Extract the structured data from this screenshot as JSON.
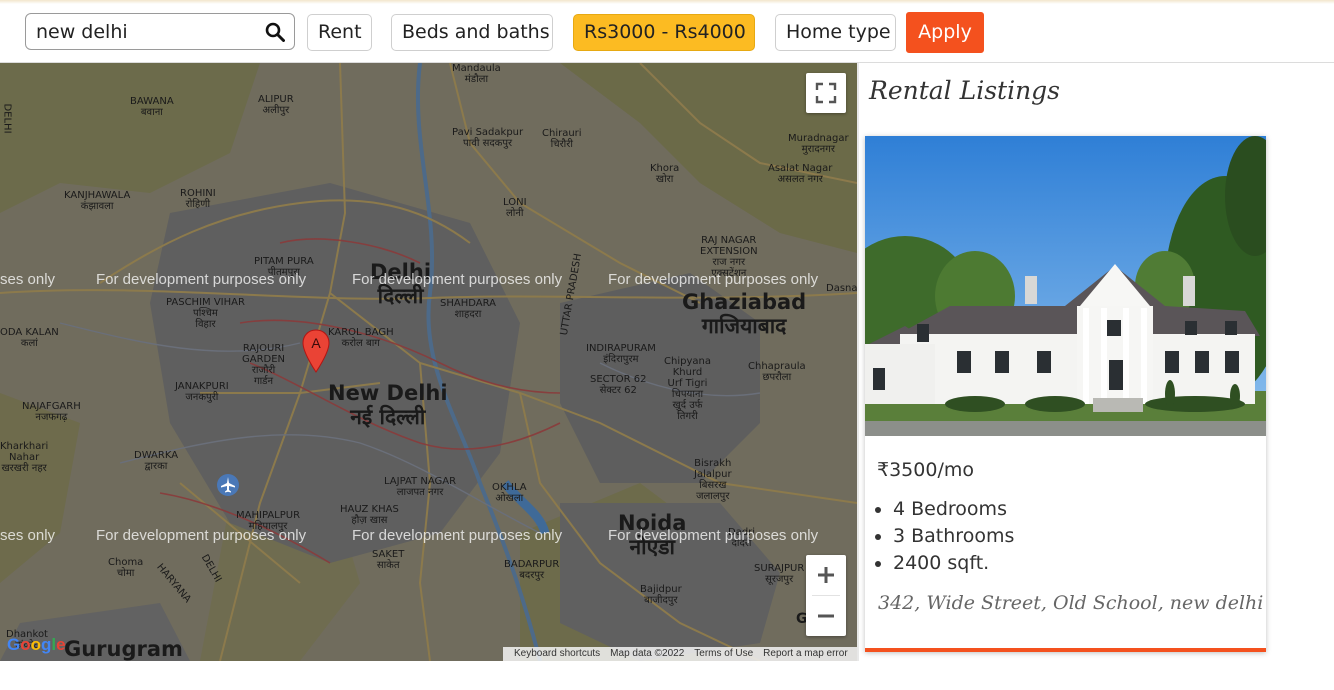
{
  "search": {
    "value": "new delhi"
  },
  "filters": {
    "rent_label": "Rent",
    "beds_baths_label": "Beds and baths",
    "price_label": "Rs3000 - Rs4000",
    "home_type_label": "Home type",
    "apply_label": "Apply"
  },
  "map": {
    "dev_watermark": "For development purposes only",
    "dev_watermark_clipped": "ses only",
    "marker_label": "A",
    "labels": {
      "delhi_en": "Delhi",
      "delhi_hi": "दिल्ली",
      "new_delhi_en": "New Delhi",
      "new_delhi_hi": "नई दिल्ली",
      "ghaziabad_en": "Ghaziabad",
      "ghaziabad_hi": "गाजियाबाद",
      "noida_en": "Noida",
      "noida_hi": "नोएडा",
      "gurugram": "Gurugram",
      "rohini": "ROHINI\nरोहिणी",
      "bawana": "BAWANA\nबवाना",
      "alipur": "ALIPUR\nअलीपुर",
      "mandaula": "Mandaula\nमंडौला",
      "pavi_sadakpur": "Pavi Sadakpur\nपावी सदकपुर",
      "chirauri": "Chirauri\nचिरौरी",
      "loni": "LONI\nलोनी",
      "khora": "Khora\nखोरा",
      "muradnagar": "Muradnagar\nमुरादनगर",
      "asalat_nagar": "Asalat Nagar\nअसलत नगर",
      "kanjhawala": "KANJHAWALA\nकंझावला",
      "raj_nagar": "RAJ NAGAR\nEXTENSION\nराज नगर\nएक्सटेंशन",
      "pitam_pura": "PITAM PURA\nपीतमपुरा",
      "paschim_vihar": "PASCHIM VIHAR\nपश्चिम\nविहार",
      "shahdara": "SHAHDARA\nशाहदरा",
      "karol_bagh": "KAROL BAGH\nकरोल बाग",
      "rajouri_garden": "RAJOURI\nGARDEN\nराजौरी\nगार्डन",
      "janakpuri": "JANAKPURI\nजनकपुरी",
      "najafgarh": "NAJAFGARH\nनजफगढ़",
      "indirapuram": "INDIRAPURAM\nइंदिरापुरम",
      "sector62": "SECTOR 62\nसेक्टर 62",
      "chipyana": "Chipyana\nKhurd\nUrf Tigri\nचिपयाना\nखुर्द उर्फ\nतिगरी",
      "chhapraula": "Chhapraula\nछपरौला",
      "kharkhari": "Kharkhari\nNahar\nखरखरी नहर",
      "dwarka": "DWARKA\nद्वारका",
      "lajpat_nagar": "LAJPAT NAGAR\nलाजपत नगर",
      "okhla": "OKHLA\nओखला",
      "mahipalpur": "MAHIPALPUR\nमहिपालपुर",
      "hauz_khas": "HAUZ KHAS\nहौज़ खास",
      "saket": "SAKET\nसाकेत",
      "bisrakh": "Bisrakh\nJalalpur\nबिसरख\nजलालपुर",
      "dadri": "Dadri\nदादरी",
      "surajpur": "SURAJPUR\nसूरजपुर",
      "badarpur": "BADARPUR\nबदरपुर",
      "bajidpur": "Bajidpur\nबाजीदपुर",
      "choma": "Choma\nचोमा",
      "haryana": "HARYANA",
      "delhi_border": "DELHI",
      "uttar_pradesh": "UTTAR PRADESH",
      "dasna": "Dasna",
      "greater": "Great",
      "dhankot": "Dhankot\nढांकोट",
      "kodla": "ODA KALAN\nकलां"
    },
    "attribution": {
      "shortcuts": "Keyboard shortcuts",
      "map_data": "Map data ©2022",
      "terms": "Terms of Use",
      "report": "Report a map error"
    },
    "google_logo": "Google"
  },
  "listings": {
    "title": "Rental Listings",
    "items": [
      {
        "price": "₹3500/mo",
        "bedrooms": "4 Bedrooms",
        "bathrooms": "3 Bathrooms",
        "area": "2400 sqft.",
        "address": "342, Wide Street, Old School, new delhi"
      }
    ]
  },
  "colors": {
    "accent": "#f4511e",
    "price_chip": "#fcbb22"
  }
}
